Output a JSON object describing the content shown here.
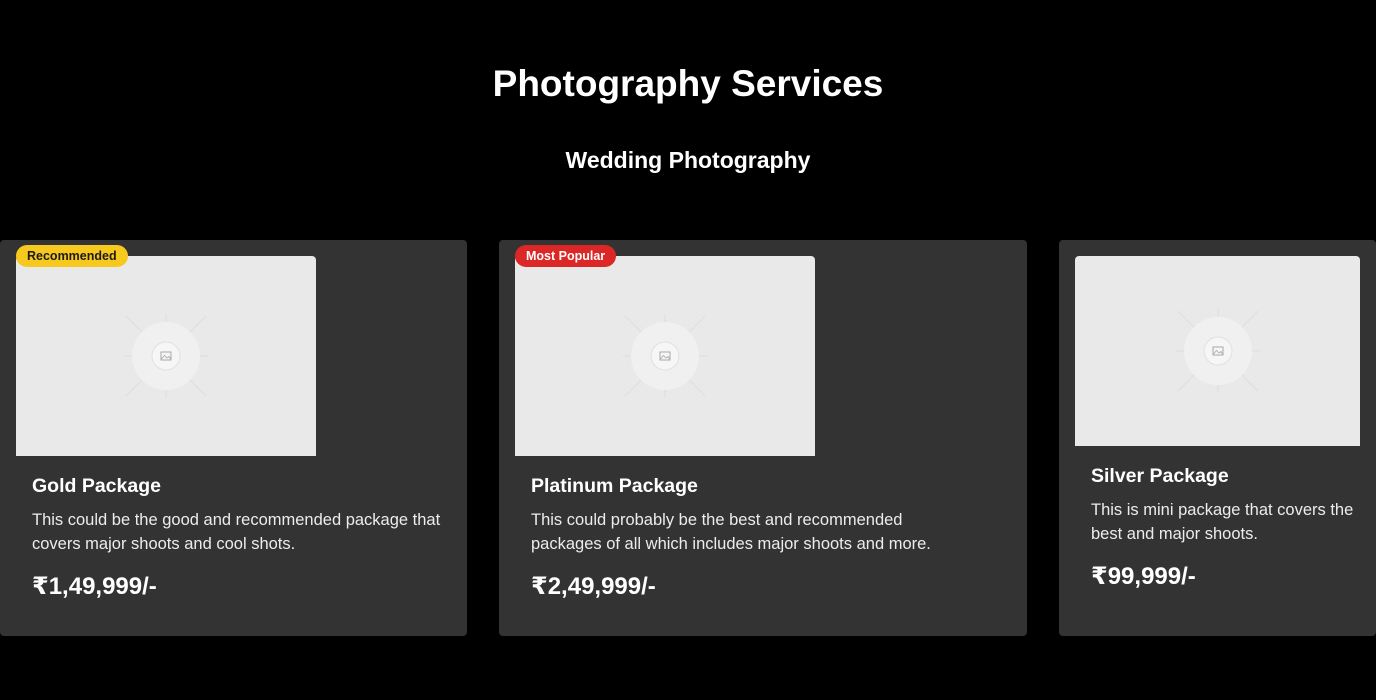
{
  "header": {
    "title": "Photography Services",
    "subtitle": "Wedding Photography"
  },
  "colors": {
    "background": "#000000",
    "card": "#333333",
    "image_placeholder": "#e9e9e9",
    "badge_recommended": "#f7c81e",
    "badge_popular": "#dc2727"
  },
  "packages": [
    {
      "badge": "Recommended",
      "image_icon": "image-placeholder-icon",
      "title": "Gold Package",
      "description": "This could be the good and recommended package that covers major shoots and cool shots.",
      "price": "₹1,49,999/-"
    },
    {
      "badge": "Most Popular",
      "image_icon": "image-placeholder-icon",
      "title": "Platinum Package",
      "description": "This could probably be the best and recommended packages of all which includes major shoots and more.",
      "price": "₹2,49,999/-"
    },
    {
      "badge": "",
      "image_icon": "image-placeholder-icon",
      "title": "Silver Package",
      "description": "This is mini package that covers the best and major shoots.",
      "price": "₹99,999/-"
    }
  ]
}
